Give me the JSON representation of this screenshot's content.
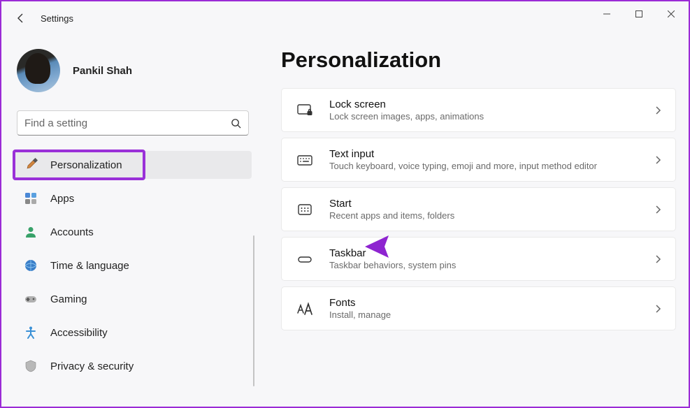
{
  "titlebar": {
    "app_title": "Settings"
  },
  "profile": {
    "username": "Pankil Shah"
  },
  "search": {
    "placeholder": "Find a setting"
  },
  "sidebar": {
    "items": [
      {
        "label": "Personalization"
      },
      {
        "label": "Apps"
      },
      {
        "label": "Accounts"
      },
      {
        "label": "Time & language"
      },
      {
        "label": "Gaming"
      },
      {
        "label": "Accessibility"
      },
      {
        "label": "Privacy & security"
      }
    ]
  },
  "main": {
    "page_title": "Personalization",
    "cards": [
      {
        "title": "Lock screen",
        "desc": "Lock screen images, apps, animations"
      },
      {
        "title": "Text input",
        "desc": "Touch keyboard, voice typing, emoji and more, input method editor"
      },
      {
        "title": "Start",
        "desc": "Recent apps and items, folders"
      },
      {
        "title": "Taskbar",
        "desc": "Taskbar behaviors, system pins"
      },
      {
        "title": "Fonts",
        "desc": "Install, manage"
      }
    ]
  }
}
